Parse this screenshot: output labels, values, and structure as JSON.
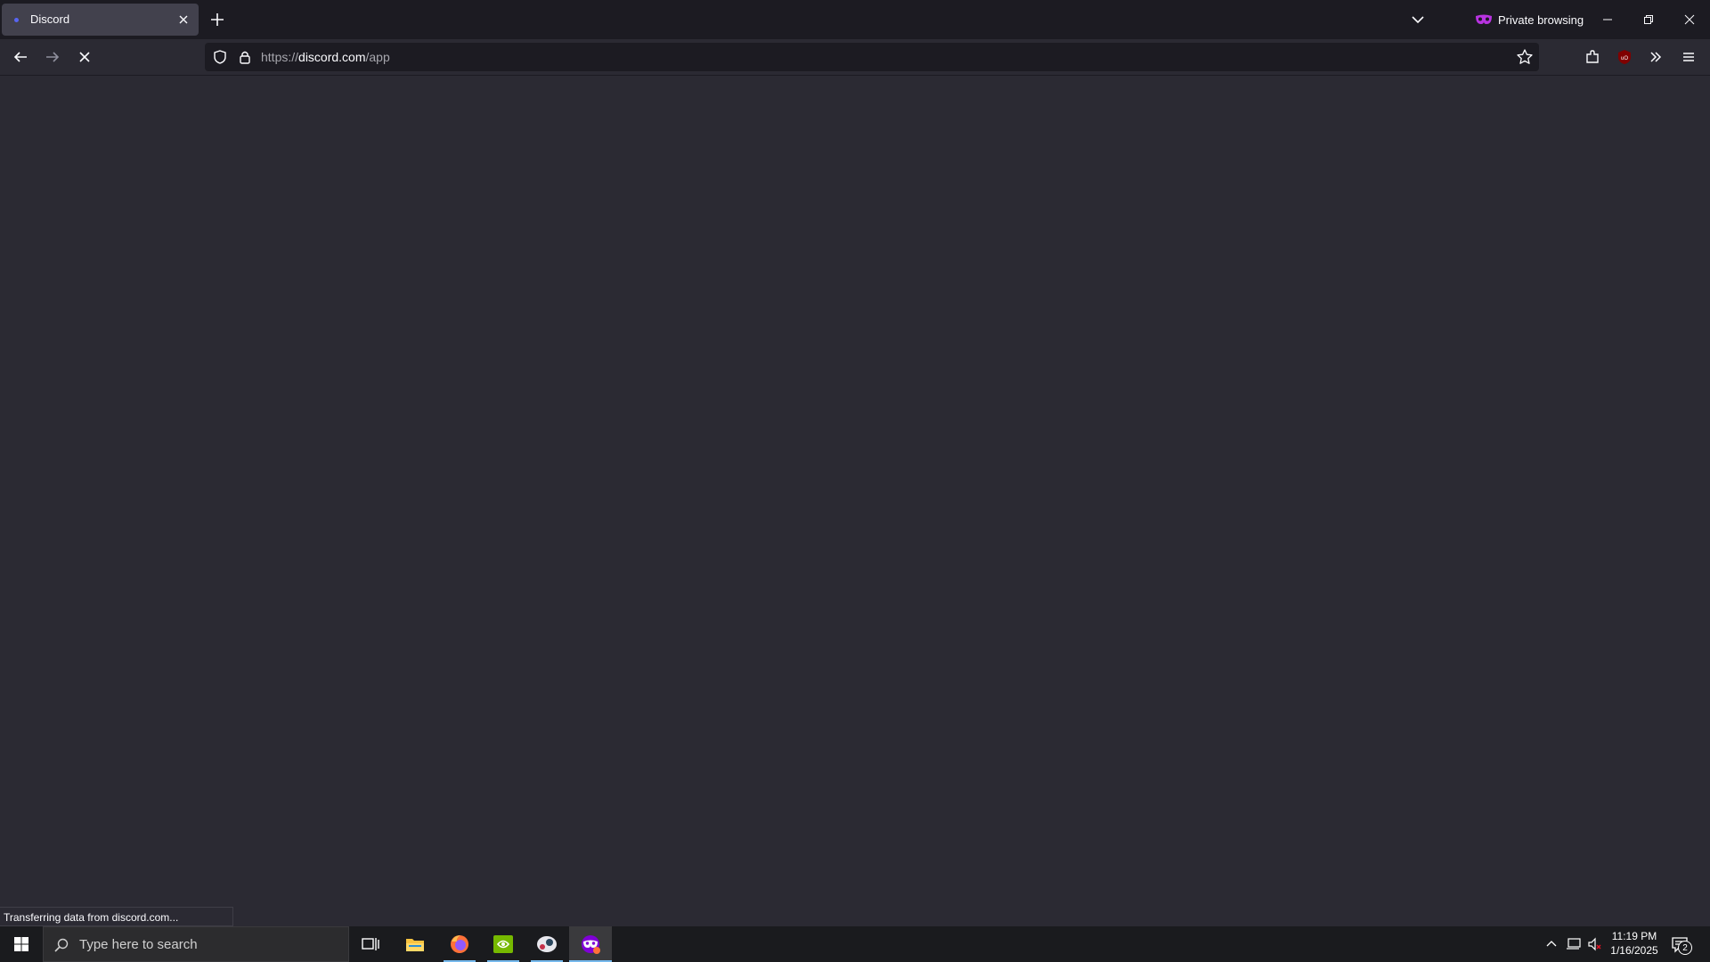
{
  "browser": {
    "tab": {
      "title": "Discord",
      "close_icon": "close-icon"
    },
    "new_tab_icon": "plus-icon",
    "list_tabs_icon": "chevron-down-icon",
    "private_label": "Private browsing",
    "window_controls": [
      "minimize-icon",
      "restore-icon",
      "close-icon"
    ],
    "nav": {
      "back_icon": "back-arrow-icon",
      "forward_icon": "forward-arrow-icon",
      "stop_icon": "stop-icon"
    },
    "url": {
      "prefix": "https://",
      "host": "discord.com",
      "path": "/app"
    },
    "toolbar_icons": [
      "star-icon",
      "extensions-icon",
      "ublock-icon",
      "overflow-icon",
      "menu-icon"
    ]
  },
  "status_text": "Transferring data from discord.com...",
  "taskbar": {
    "search_placeholder": "Type here to search",
    "apps": [
      "task-view-icon",
      "file-explorer-icon",
      "firefox-icon",
      "nvidia-icon",
      "steam-icon",
      "firefox-private-icon"
    ],
    "clock": {
      "time": "11:19 PM",
      "date": "1/16/2025"
    },
    "notification_count": "2"
  },
  "colors": {
    "tab_strip": "#1c1b22",
    "content_bg": "#2b2a33",
    "url_bg": "#1c1b22",
    "private_purple": "#8000d7",
    "taskbar": "#1a1b1e"
  }
}
